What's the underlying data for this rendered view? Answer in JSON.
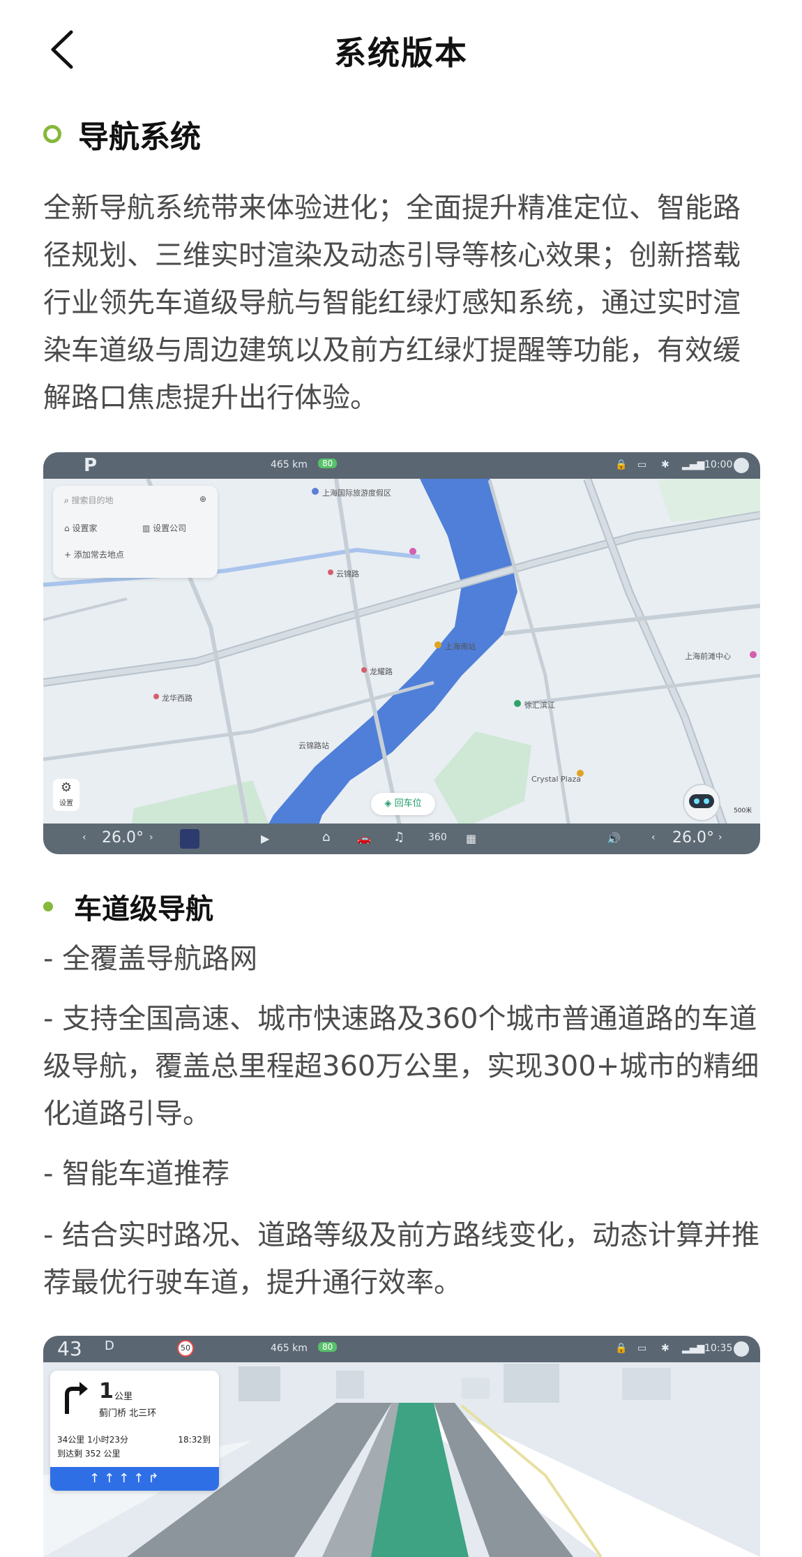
{
  "header": {
    "title": "系统版本"
  },
  "section_nav": {
    "title": "导航系统",
    "description": "全新导航系统带来体验进化；全面提升精准定位、智能路径规划、三维实时渲染及动态引导等核心效果；创新搭载行业领先车道级导航与智能红绿灯感知系统，通过实时渲染车道级与周边建筑以及前方红绿灯提醒等功能，有效缓解路口焦虑提升出行体验。"
  },
  "screen1": {
    "gear": "P",
    "range": "465 km",
    "battery_pct": "80",
    "time": "10:00",
    "search_placeholder": "搜索目的地",
    "set_home": "设置家",
    "set_company": "设置公司",
    "add_frequent": "添加常去地点",
    "back_to_car": "回车位",
    "settings": "设置",
    "temp_left": "26.0°",
    "temp_right": "26.0°",
    "scale": "500米",
    "map_labels": [
      "上海国际旅游度假区",
      "云锦路",
      "龙耀路",
      "上海南站",
      "Crystal Plaza",
      "徐汇滨江",
      "龙华西路",
      "上海前滩中心",
      "云锦路站"
    ]
  },
  "section_lane": {
    "title": "车道级导航",
    "item1_title": "- 全覆盖导航路网",
    "item1_desc": "- 支持全国高速、城市快速路及360个城市普通道路的车道级导航，覆盖总里程超360万公里，实现300+城市的精细化道路引导。",
    "item2_title": "- 智能车道推荐",
    "item2_desc": "- 结合实时路况、道路等级及前方路线变化，动态计算并推荐最优行驶车道，提升通行效率。"
  },
  "screen2": {
    "speed": "43",
    "gear": "D",
    "speed_limit": "50",
    "range": "465 km",
    "battery_pct": "80",
    "time": "10:35",
    "turn_distance": "1",
    "turn_unit": "公里",
    "turn_road": "蓟门桥 北三环",
    "trip_summary": "34公里 1小时23分",
    "arrival_time": "18:32到",
    "remaining_range": "到达剩 352 公里",
    "lane_arrows": "↑↑↑↑↱"
  },
  "colors": {
    "accent": "#86b83b",
    "water": "#4f7fd8",
    "nav_blue": "#2f6fe6"
  }
}
